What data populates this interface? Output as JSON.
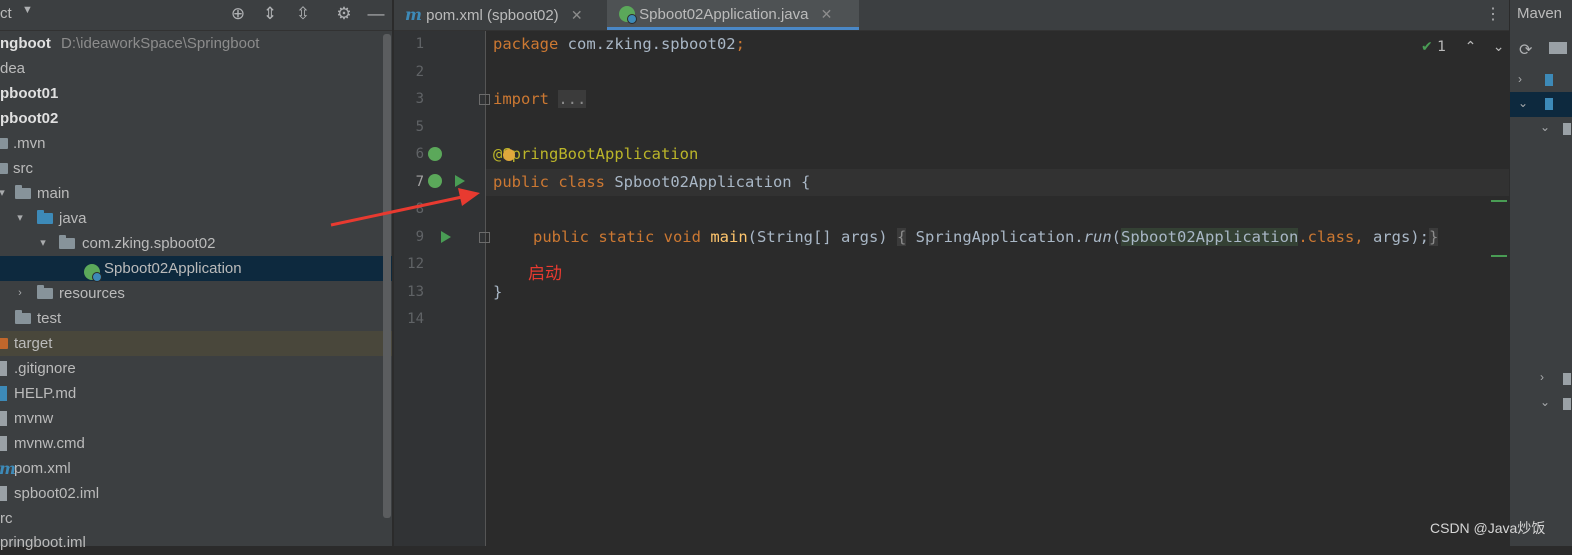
{
  "project_panel": {
    "title": "ct",
    "tree": [
      {
        "name": "ngboot",
        "path": "D:\\ideaworkSpace\\Springboot",
        "kind": "root"
      },
      {
        "name": "dea",
        "kind": "folder"
      },
      {
        "name": "pboot01",
        "kind": "module"
      },
      {
        "name": "pboot02",
        "kind": "module"
      },
      {
        "name": ".mvn",
        "kind": "folder"
      },
      {
        "name": "src",
        "kind": "folder"
      },
      {
        "name": "main",
        "kind": "folder"
      },
      {
        "name": "java",
        "kind": "source-folder"
      },
      {
        "name": "com.zking.spboot02",
        "kind": "package"
      },
      {
        "name": "Spboot02Application",
        "kind": "spring-class"
      },
      {
        "name": "resources",
        "kind": "resource-folder"
      },
      {
        "name": "test",
        "kind": "folder"
      },
      {
        "name": "target",
        "kind": "excluded-folder"
      },
      {
        "name": ".gitignore",
        "kind": "file"
      },
      {
        "name": "HELP.md",
        "kind": "markdown"
      },
      {
        "name": "mvnw",
        "kind": "file"
      },
      {
        "name": "mvnw.cmd",
        "kind": "file"
      },
      {
        "name": "pom.xml",
        "kind": "maven"
      },
      {
        "name": "spboot02.iml",
        "kind": "file"
      },
      {
        "name": "rc",
        "kind": "folder"
      },
      {
        "name": "pringboot.iml",
        "kind": "file"
      }
    ]
  },
  "tabs": [
    {
      "label": "pom.xml (spboot02)",
      "icon": "maven-icon"
    },
    {
      "label": "Spboot02Application.java",
      "icon": "spring-boot-icon"
    }
  ],
  "editor": {
    "line_numbers": [
      "1",
      "2",
      "3",
      "5",
      "6",
      "7",
      "8",
      "9",
      "12",
      "13",
      "14"
    ],
    "lines": {
      "l1_kw": "package",
      "l1_rest": " com.zking.spboot02",
      "l1_semi": ";",
      "l3_kw": "import",
      "l3_fold": "...",
      "l6_at": "@",
      "l6_ann": "SpringBootApplication",
      "l7_kw": "public class",
      "l7_cls": "Spboot02Application",
      "l7_brace": " {",
      "l9_kw": "public static void",
      "l9_fn": "main",
      "l9_args": "(String[] args)",
      "l9_open": "{",
      "l9_call": "SpringApplication.",
      "l9_run": "run",
      "l9_paren": "(",
      "l9_ref": "Spboot02Application",
      "l9_class": ".class,",
      "l9_tail": " args);",
      "l9_close": "}",
      "l13": "}"
    },
    "inspection_count": "1"
  },
  "annotation_note": "启动",
  "maven": {
    "title": "Maven"
  },
  "watermark": "CSDN @Java炒饭",
  "colors": {
    "accent": "#4a88c7",
    "annotation_arrow": "#e83a30",
    "run_green": "#499c54"
  }
}
